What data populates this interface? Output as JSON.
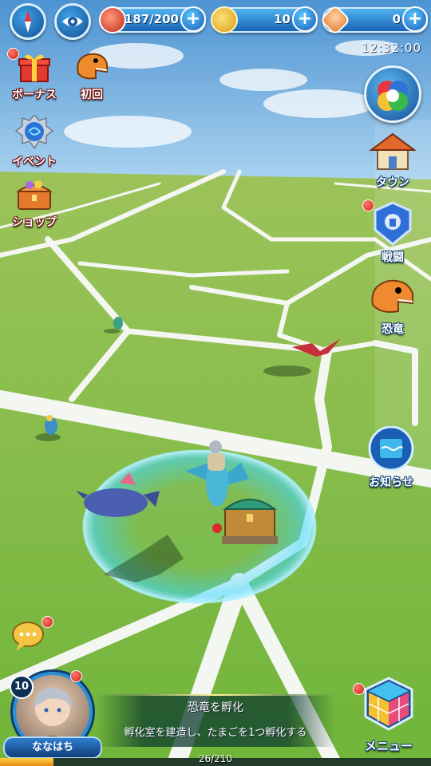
{
  "top_bar": {
    "compass_icon": "compass-icon",
    "view_icon": "eye-icon",
    "stamina": {
      "value": "187/200",
      "icon": "meat-icon",
      "current": 187,
      "max": 200
    },
    "coins": {
      "value": "10",
      "icon": "coin-icon"
    },
    "gems": {
      "value": "0",
      "icon": "gem-icon"
    },
    "plus_label": "+"
  },
  "clock": "12:32:00",
  "left_menu": [
    {
      "label": "ボーナス",
      "icon": "gift-icon"
    },
    {
      "label": "初回",
      "icon": "dinosaur-head-icon"
    },
    {
      "label": "イベント",
      "icon": "event-orb-icon"
    },
    {
      "label": "ショップ",
      "icon": "treasure-chest-icon"
    }
  ],
  "right_menu": [
    {
      "label": "タウン",
      "icon": "house-icon"
    },
    {
      "label": "戦闘",
      "icon": "battle-icon"
    },
    {
      "label": "恐竜",
      "icon": "dinosaur-head-icon"
    },
    {
      "label": "お知らせ",
      "icon": "notice-icon"
    }
  ],
  "player": {
    "level": "10",
    "name": "ななはち"
  },
  "quest": {
    "title": "恐竜を孵化",
    "description": "孵化室を建造し、たまごを1つ孵化する"
  },
  "experience": {
    "text": "26/210",
    "current": 26,
    "max": 210
  },
  "menu_button": {
    "label": "メニュー"
  },
  "colors": {
    "grass": "#6fb03c",
    "road": "#f4f6f2",
    "accent_blue": "#1a64b4",
    "notification_red": "#d51d12",
    "ring": "#3fd6ff"
  }
}
